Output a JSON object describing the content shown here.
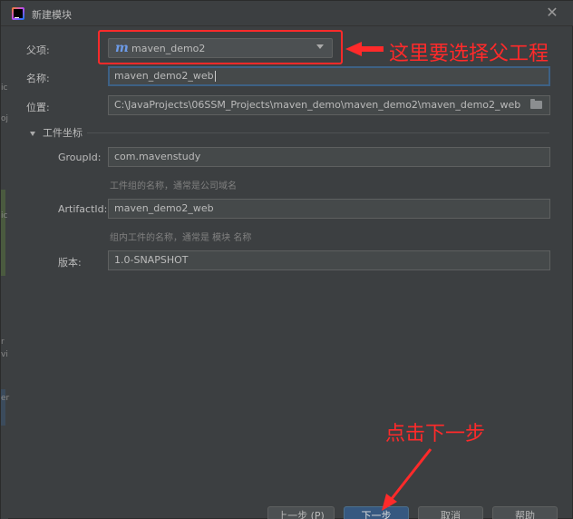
{
  "window": {
    "title": "新建模块"
  },
  "form": {
    "parent_label": "父项:",
    "parent_value": "maven_demo2",
    "parent_icon": "maven-module-icon",
    "name_label": "名称:",
    "name_value": "maven_demo2_web",
    "location_label": "位置:",
    "location_value": "C:\\JavaProjects\\06SSM_Projects\\maven_demo\\maven_demo2\\maven_demo2_web"
  },
  "coords": {
    "section_title": "工件坐标",
    "groupid_label": "GroupId:",
    "groupid_value": "com.mavenstudy",
    "groupid_hint": "工件组的名称，通常是公司域名",
    "artifactid_label": "ArtifactId:",
    "artifactid_value": "maven_demo2_web",
    "artifactid_hint": "组内工件的名称，通常是 模块 名称",
    "version_label": "版本:",
    "version_value": "1.0-SNAPSHOT"
  },
  "footer": {
    "prev": "上一步 (P)",
    "next": "下一步",
    "cancel": "取消",
    "help": "帮助"
  },
  "annotations": {
    "parent_note": "这里要选择父工程",
    "next_note": "点击下一步",
    "color": "#ff2a2a"
  },
  "colors": {
    "dialog_bg": "#3c3f41",
    "field_bg": "#45494a",
    "focus_border": "#3d6185",
    "primary_button": "#365880"
  },
  "edge_marks": [
    "ic",
    "oj",
    "ic",
    "r",
    "vi",
    "er"
  ]
}
